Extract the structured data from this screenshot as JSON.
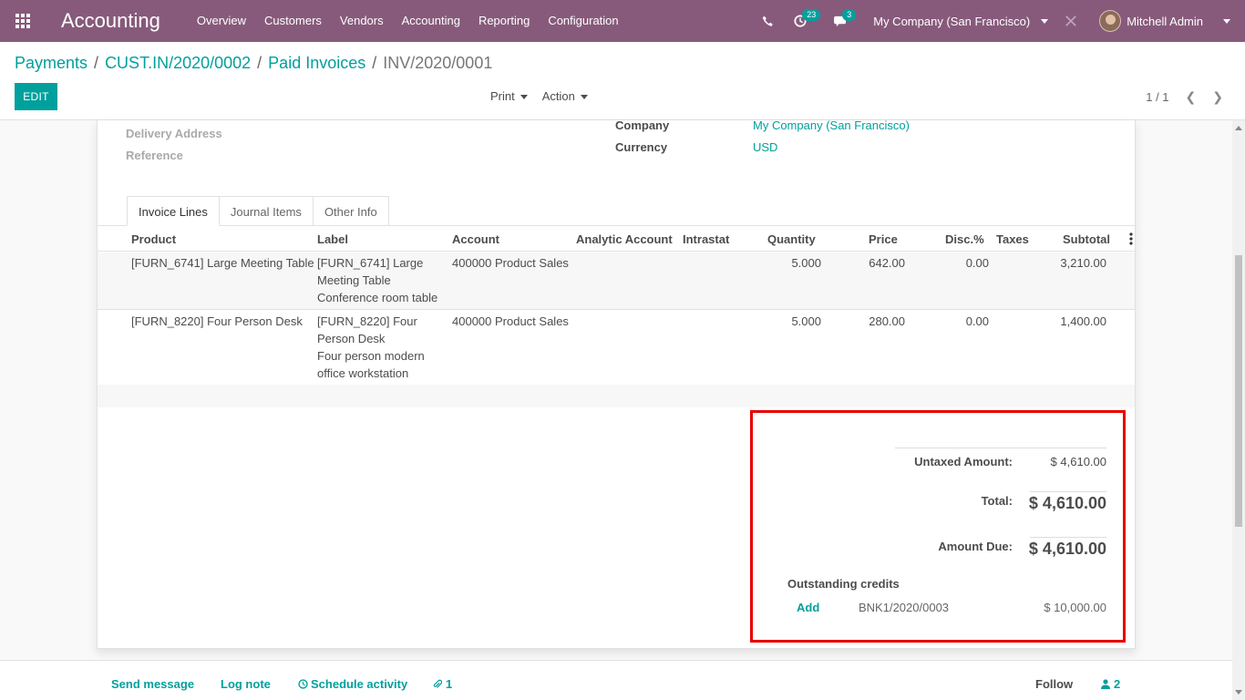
{
  "navbar": {
    "app_name": "Accounting",
    "menu": [
      "Overview",
      "Customers",
      "Vendors",
      "Accounting",
      "Reporting",
      "Configuration"
    ],
    "activity_count": "23",
    "message_count": "3",
    "company": "My Company (San Francisco)",
    "user": "Mitchell Admin"
  },
  "breadcrumb": {
    "items": [
      "Payments",
      "CUST.IN/2020/0002",
      "Paid Invoices"
    ],
    "current": "INV/2020/0001"
  },
  "control": {
    "edit_label": "EDIT",
    "print_label": "Print",
    "action_label": "Action",
    "pager": "1 / 1"
  },
  "fields": {
    "delivery_address_label": "Delivery Address",
    "reference_label": "Reference",
    "company_label": "Company",
    "company_value": "My Company (San Francisco)",
    "currency_label": "Currency",
    "currency_value": "USD"
  },
  "tabs": [
    "Invoice Lines",
    "Journal Items",
    "Other Info"
  ],
  "columns": [
    "Product",
    "Label",
    "Account",
    "Analytic Account",
    "Intrastat",
    "Quantity",
    "Price",
    "Disc.%",
    "Taxes",
    "Subtotal"
  ],
  "lines": [
    {
      "product": "[FURN_6741] Large Meeting Table",
      "label_lines": [
        "[FURN_6741] Large",
        "Meeting Table",
        "Conference room table"
      ],
      "account": "400000 Product Sales",
      "quantity": "5.000",
      "price": "642.00",
      "discount": "0.00",
      "subtotal": "3,210.00"
    },
    {
      "product": "[FURN_8220] Four Person Desk",
      "label_lines": [
        "[FURN_8220] Four",
        "Person Desk",
        "Four person modern",
        "office workstation"
      ],
      "account": "400000 Product Sales",
      "quantity": "5.000",
      "price": "280.00",
      "discount": "0.00",
      "subtotal": "1,400.00"
    }
  ],
  "totals": {
    "untaxed_label": "Untaxed Amount:",
    "untaxed_value": "$ 4,610.00",
    "total_label": "Total:",
    "total_value": "$ 4,610.00",
    "due_label": "Amount Due:",
    "due_value": "$ 4,610.00",
    "outstanding_title": "Outstanding credits",
    "add_label": "Add",
    "credit_ref": "BNK1/2020/0003",
    "credit_amount": "$ 10,000.00"
  },
  "chatter": {
    "send_message": "Send message",
    "log_note": "Log note",
    "schedule_activity": "Schedule activity",
    "attachments": "1",
    "follow": "Follow",
    "followers": "2"
  },
  "colors": {
    "brand": "#875a7b",
    "accent": "#00a09d",
    "highlight": "#e60000"
  }
}
